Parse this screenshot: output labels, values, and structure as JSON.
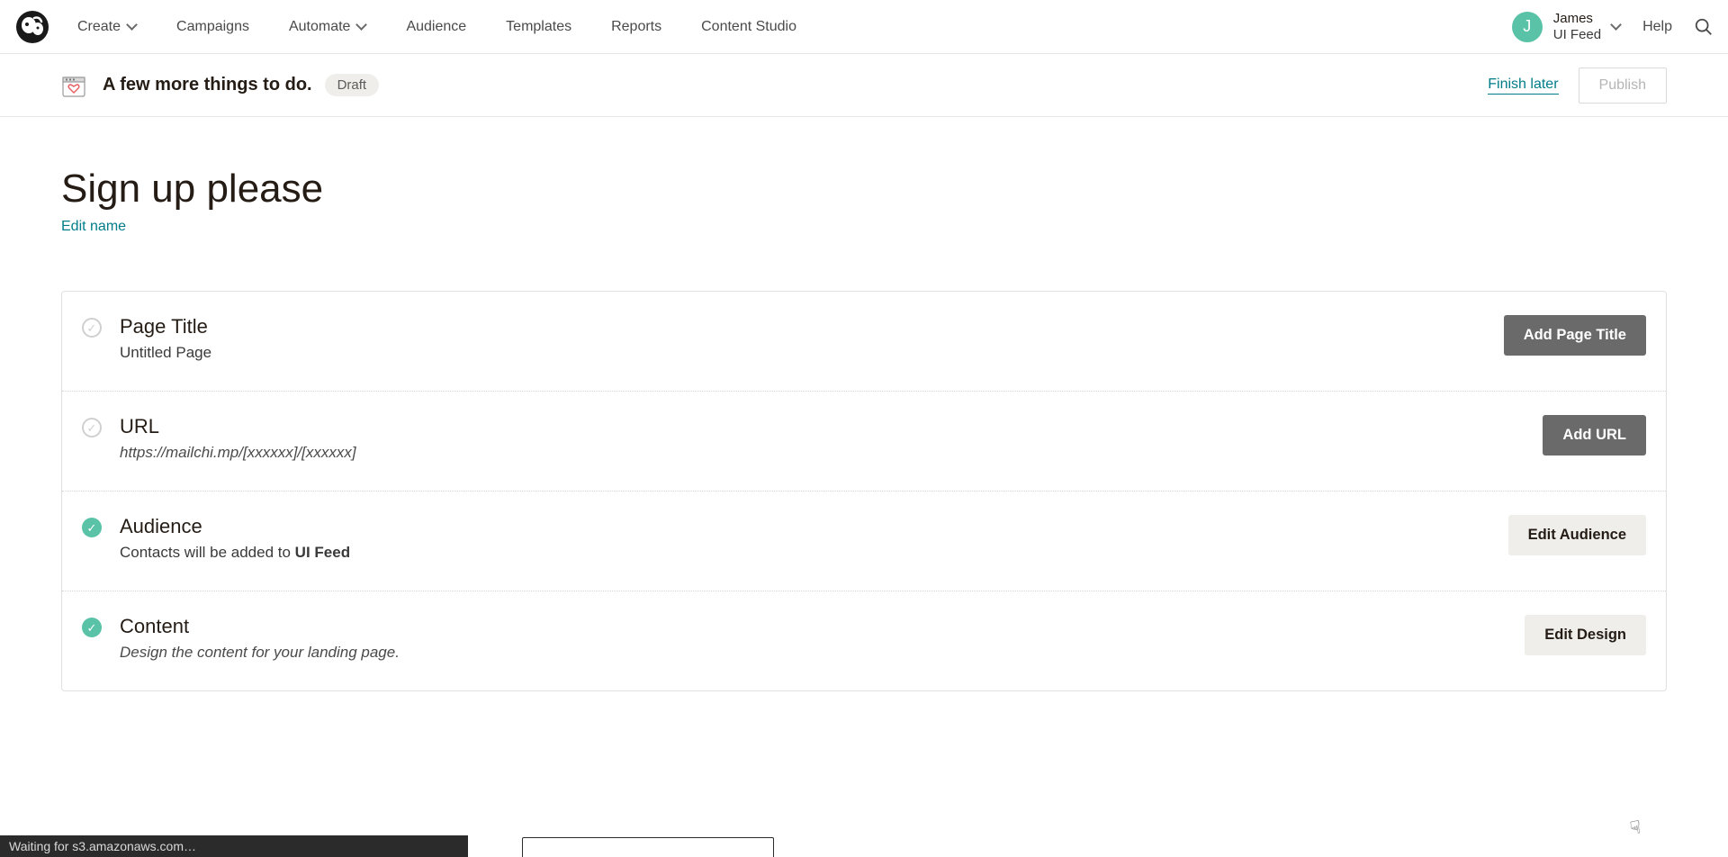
{
  "topnav": {
    "items": [
      {
        "label": "Create",
        "dropdown": true
      },
      {
        "label": "Campaigns",
        "dropdown": false
      },
      {
        "label": "Automate",
        "dropdown": true
      },
      {
        "label": "Audience",
        "dropdown": false
      },
      {
        "label": "Templates",
        "dropdown": false
      },
      {
        "label": "Reports",
        "dropdown": false
      },
      {
        "label": "Content Studio",
        "dropdown": false
      }
    ],
    "account": {
      "initial": "J",
      "name": "James",
      "feed": "UI Feed"
    },
    "help": "Help"
  },
  "subheader": {
    "title": "A few more things to do.",
    "badge": "Draft",
    "finish_later": "Finish later",
    "publish": "Publish"
  },
  "main": {
    "title": "Sign up please",
    "edit_name": "Edit name"
  },
  "cards": [
    {
      "title": "Page Title",
      "subtitle": "Untitled Page",
      "italic": false,
      "complete": false,
      "button": "Add Page Title",
      "btn_style": "dark"
    },
    {
      "title": "URL",
      "subtitle": "https://mailchi.mp/[xxxxxx]/[xxxxxx]",
      "italic": true,
      "complete": false,
      "button": "Add URL",
      "btn_style": "dark"
    },
    {
      "title": "Audience",
      "subtitle_prefix": "Contacts will be added to ",
      "subtitle_bold": "UI Feed",
      "italic": false,
      "complete": true,
      "button": "Edit Audience",
      "btn_style": "light"
    },
    {
      "title": "Content",
      "subtitle": "Design the content for your landing page.",
      "italic": true,
      "complete": true,
      "button": "Edit Design",
      "btn_style": "light"
    }
  ],
  "statusbar": "Waiting for s3.amazonaws.com…"
}
